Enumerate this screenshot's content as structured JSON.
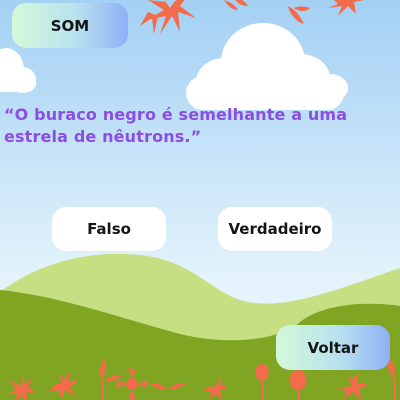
{
  "game": {
    "sound_label": "SOM",
    "question": "“O buraco negro é semelhante a uma estrela de nêutrons.”",
    "answers": {
      "false_label": "Falso",
      "true_label": "Verdadeiro"
    },
    "back_label": "Voltar"
  },
  "colors": {
    "sky_top": "#a3d0f4",
    "sky_bottom": "#e4f3fb",
    "hill_light": "#c6df83",
    "hill_dark": "#7fa522",
    "flower": "#f36b4a",
    "question_text": "#8a4fe0",
    "button_gradient": [
      "#d4f8da",
      "#b8e2ee",
      "#8fb0f7"
    ]
  }
}
